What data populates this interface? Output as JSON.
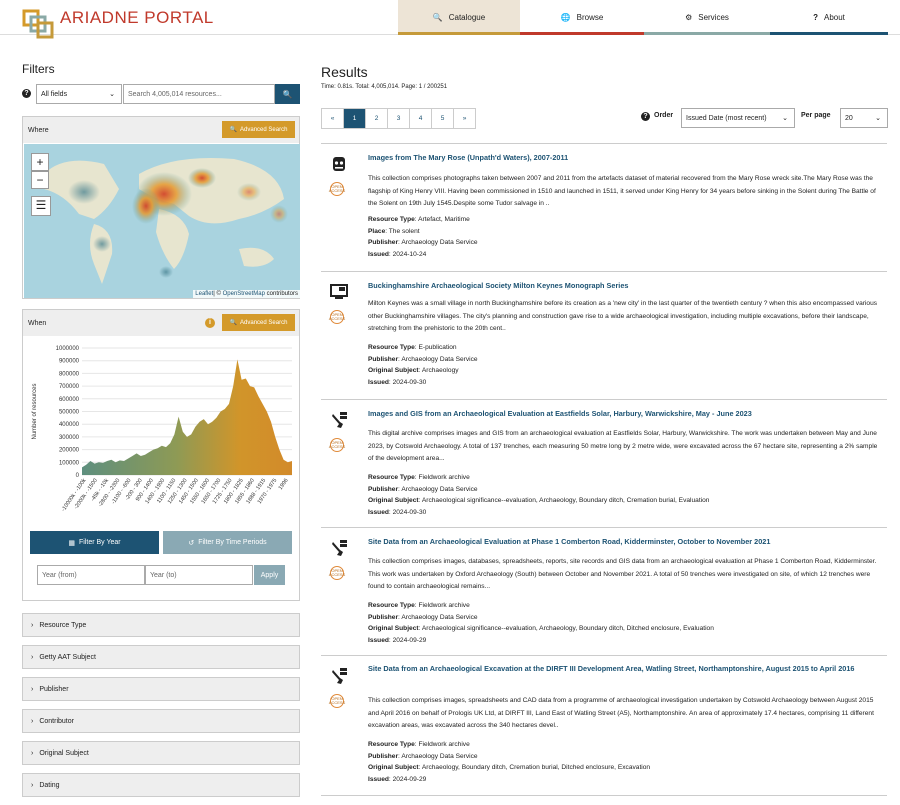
{
  "header": {
    "brand": "ARIADNE PORTAL",
    "nav": [
      {
        "label": "Catalogue",
        "icon": "search-icon",
        "color": "#c59a3a",
        "active": true
      },
      {
        "label": "Browse",
        "icon": "globe-icon",
        "color": "#c0392b"
      },
      {
        "label": "Services",
        "icon": "gear-icon",
        "color": "#8aa9a6"
      },
      {
        "label": "About",
        "icon": "question-icon",
        "color": "#1d5373"
      }
    ]
  },
  "filters": {
    "title": "Filters",
    "field_select": "All fields",
    "search_placeholder": "Search 4,005,014 resources...",
    "where": {
      "label": "Where",
      "advanced": "Advanced Search",
      "attribution_a": "Leaflet",
      "attribution_b": "| © ",
      "attribution_c": "OpenStreetMap",
      "attribution_d": " contributors"
    },
    "when": {
      "label": "When",
      "advanced": "Advanced Search",
      "ylabel": "Number of resources",
      "yticks": [
        "1000000",
        "900000",
        "800000",
        "700000",
        "600000",
        "500000",
        "400000",
        "300000",
        "200000",
        "100000",
        "0"
      ],
      "xticks": [
        "-10000k - -100k",
        "-2000k - -1500",
        "-45k - -10k",
        "-2800 - -2300",
        "-1100 - -600",
        "-200 - 300",
        "900 - 1400",
        "1400 - 1900",
        "1100 - 1150",
        "1250 - 1300",
        "1450 - 1500",
        "1550 - 1600",
        "1650 - 1700",
        "1725 - 1750",
        "1800 - 1825",
        "1855 - 1860",
        "1888 - 1915",
        "1970 - 1975",
        "1996"
      ],
      "tab_year": "Filter By Year",
      "tab_periods": "Filter By Time Periods",
      "from_placeholder": "Year (from)",
      "to_placeholder": "Year (to)",
      "apply": "Apply"
    },
    "accordions": [
      "Resource Type",
      "Getty AAT Subject",
      "Publisher",
      "Contributor",
      "Original Subject",
      "Dating"
    ]
  },
  "chart_data": {
    "type": "area",
    "ylabel": "Number of resources",
    "ylim": [
      0,
      1000000
    ],
    "values": [
      60000,
      80000,
      110000,
      90000,
      100000,
      95000,
      110000,
      120000,
      100000,
      115000,
      110000,
      130000,
      150000,
      170000,
      150000,
      160000,
      180000,
      200000,
      210000,
      230000,
      220000,
      250000,
      320000,
      460000,
      340000,
      300000,
      320000,
      380000,
      420000,
      440000,
      400000,
      420000,
      450000,
      500000,
      520000,
      560000,
      700000,
      910000,
      750000,
      760000,
      700000,
      690000,
      620000,
      560000,
      500000,
      420000,
      300000,
      200000,
      120000,
      100000,
      110000
    ]
  },
  "results": {
    "title": "Results",
    "meta": "Time: 0.81s. Total: 4,005,014. Page: 1 / 200251",
    "pages": [
      "«",
      "1",
      "2",
      "3",
      "4",
      "5",
      "»"
    ],
    "order_label": "Order",
    "order_value": "Issued Date (most recent)",
    "perpage_label": "Per page",
    "perpage_value": "20",
    "items": [
      {
        "title": "Images from The Mary Rose (Unpath'd Waters), 2007-2011",
        "icon": "image-icon",
        "desc": "This collection comprises photographs taken between 2007 and 2011 from the artefacts dataset of material recovered from the Mary Rose wreck site.The Mary Rose was the flagship of King Henry VIII. Having been commissioned in 1510 and launched in 1511, it served under King Henry for 34 years before sinking in the Solent during The Battle of the Solent on 19th July 1545.Despite some Tudor salvage in ..",
        "fields": [
          [
            "Resource Type",
            "Artefact, Maritime"
          ],
          [
            "Place",
            "The solent"
          ],
          [
            "Publisher",
            "Archaeology Data Service"
          ],
          [
            "Issued",
            "2024-10-24"
          ]
        ]
      },
      {
        "title": "Buckinghamshire Archaeological Society Milton Keynes Monograph Series",
        "icon": "computer-icon",
        "desc": "Milton Keynes was a small village in north Buckinghamshire before its creation as a 'new city' in the last quarter of the twentieth century ? when this also encompassed various other Buckinghamshire villages. The city's planning and construction gave rise to a wide archaeological investigation, including multiple excavations, before their landscape, stretching from the prehistoric to the 20th cent..",
        "fields": [
          [
            "Resource Type",
            "E-publication"
          ],
          [
            "Publisher",
            "Archaeology Data Service"
          ],
          [
            "Original Subject",
            "Archaeology"
          ],
          [
            "Issued",
            "2024-09-30"
          ]
        ]
      },
      {
        "title": "Images and GIS from an Archaeological Evaluation at Eastfields Solar, Harbury, Warwickshire, May - June 2023",
        "icon": "fieldwork-icon",
        "desc": "This digital archive comprises images and GIS from an archaeological evaluation at Eastfields Solar, Harbury, Warwickshire. The work was undertaken between May and June 2023, by Cotswold Archaeology. A total of 137 trenches, each measuring 50 metre long by 2 metre wide, were excavated across the 67 hectare site, representing a 2% sample of the development area...",
        "fields": [
          [
            "Resource Type",
            "Fieldwork archive"
          ],
          [
            "Publisher",
            "Archaeology Data Service"
          ],
          [
            "Original Subject",
            "Archaeological significance--evaluation, Archaeology, Boundary ditch, Cremation burial, Evaluation"
          ],
          [
            "Issued",
            "2024-09-30"
          ]
        ]
      },
      {
        "title": "Site Data from an Archaeological Evaluation at Phase 1 Comberton Road, Kidderminster, October to November 2021",
        "icon": "fieldwork-icon",
        "desc": "This collection comprises images, databases, spreadsheets, reports, site records and GIS data from an archaeological evaluation at Phase 1 Comberton Road, Kidderminster. This work was undertaken by Oxford Archaeology (South) between October and November 2021. A total of 50 trenches were investigated on site, of which 12 trenches were found to contain archaeological remains...",
        "fields": [
          [
            "Resource Type",
            "Fieldwork archive"
          ],
          [
            "Publisher",
            "Archaeology Data Service"
          ],
          [
            "Original Subject",
            "Archaeological significance--evaluation, Archaeology, Boundary ditch, Ditched enclosure, Evaluation"
          ],
          [
            "Issued",
            "2024-09-29"
          ]
        ]
      },
      {
        "title": "Site Data from an Archaeological Excavation at the DIRFT III Development Area, Watling Street, Northamptonshire, August 2015 to April 2016",
        "icon": "fieldwork-icon",
        "desc": "This collection comprises images, spreadsheets and CAD data from a programme of archaeological investigation undertaken by Cotswold Archaeology between August 2015 and April 2016 on behalf of Prologis UK Ltd, at DIRFT III, Land East of Watling Street (A5), Northamptonshire. An area of approximately 17.4 hectares, comprising 11 different excavation areas, was excavated across the 340 hectares devel..",
        "fields": [
          [
            "Resource Type",
            "Fieldwork archive"
          ],
          [
            "Publisher",
            "Archaeology Data Service"
          ],
          [
            "Original Subject",
            "Archaeology, Boundary ditch, Cremation burial, Ditched enclosure, Excavation"
          ],
          [
            "Issued",
            "2024-09-29"
          ]
        ]
      }
    ],
    "badge_text": "OPEN ACCESS"
  }
}
